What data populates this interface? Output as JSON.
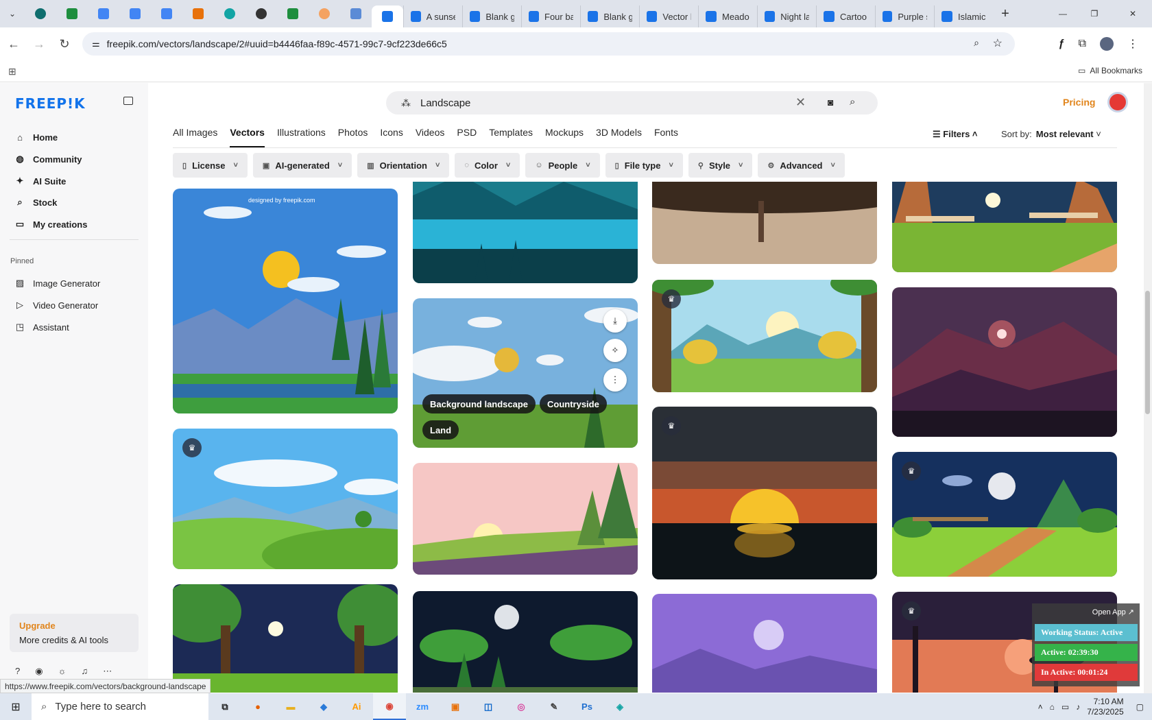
{
  "browser": {
    "tabs": [
      {
        "title": "A sunse",
        "color": "#1a73e8"
      },
      {
        "title": "Blank g",
        "color": "#1a73e8"
      },
      {
        "title": "Four ba",
        "color": "#1a73e8"
      },
      {
        "title": "Blank g",
        "color": "#1a73e8"
      },
      {
        "title": "Vector l",
        "color": "#1a73e8"
      },
      {
        "title": "Meado",
        "color": "#1a73e8"
      },
      {
        "title": "Night la",
        "color": "#1a73e8"
      },
      {
        "title": "Cartoo",
        "color": "#1a73e8"
      },
      {
        "title": "Purple s",
        "color": "#1a73e8"
      },
      {
        "title": "Islamic",
        "color": "#1a73e8"
      }
    ],
    "new_tab_symbol": "+",
    "url": "freepik.com/vectors/landscape/2#uuid=b4446faa-f89c-4571-99c7-9cf223de66c5",
    "bookmarks_label": "All Bookmarks"
  },
  "sidebar": {
    "logo": "FREEP!K",
    "nav": [
      {
        "label": "Home",
        "icon": "⌂"
      },
      {
        "label": "Community",
        "icon": "◍"
      },
      {
        "label": "AI Suite",
        "icon": "✦"
      },
      {
        "label": "Stock",
        "icon": "⌕"
      },
      {
        "label": "My creations",
        "icon": "▭"
      }
    ],
    "pinned_label": "Pinned",
    "pinned": [
      {
        "label": "Image Generator",
        "icon": "▨"
      },
      {
        "label": "Video Generator",
        "icon": "▷"
      },
      {
        "label": "Assistant",
        "icon": "◳"
      }
    ],
    "upgrade_title": "Upgrade",
    "upgrade_subtitle": "More credits & AI tools"
  },
  "search": {
    "query": "Landscape"
  },
  "header": {
    "pricing": "Pricing"
  },
  "type_tabs": [
    "All Images",
    "Vectors",
    "Illustrations",
    "Photos",
    "Icons",
    "Videos",
    "PSD",
    "Templates",
    "Mockups",
    "3D Models",
    "Fonts"
  ],
  "active_type_tab": "Vectors",
  "filters_label": "Filters",
  "sort": {
    "label": "Sort by:",
    "value": "Most relevant"
  },
  "filter_chips": [
    {
      "label": "License",
      "icon": "▯"
    },
    {
      "label": "AI-generated",
      "icon": "▣"
    },
    {
      "label": "Orientation",
      "icon": "▥"
    },
    {
      "label": "Color",
      "icon": "◌"
    },
    {
      "label": "People",
      "icon": "☺"
    },
    {
      "label": "File type",
      "icon": "▯"
    },
    {
      "label": "Style",
      "icon": "⚲"
    },
    {
      "label": "Advanced",
      "icon": "⚙"
    }
  ],
  "designed_by": "designed by freepik.com",
  "hovered_card_tags": [
    "Background landscape",
    "Countryside",
    "Land"
  ],
  "status_url": "https://www.freepik.com/vectors/background-landscape",
  "work_widget": {
    "open_app": "Open App ↗",
    "status": "Working Status: Active",
    "active": "Active: 02:39:30",
    "inactive": "In Active: 00:01:24",
    "status_color": "#5bbfd0",
    "active_color": "#35b34a",
    "inactive_color": "#e03a3a"
  },
  "taskbar": {
    "search_placeholder": "Type here to search",
    "time": "7:10 AM",
    "date": "7/23/2025"
  }
}
